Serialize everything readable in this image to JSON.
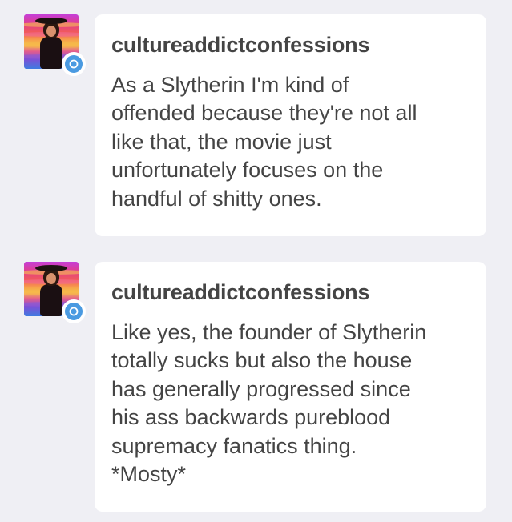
{
  "replies": [
    {
      "username": "cultureaddictconfessions",
      "avatar": "user-avatar-portrait",
      "badge_icon": "chat-bubble-icon",
      "message": "As a Slytherin I'm kind of\noffended because they're not all\nlike that, the movie just\nunfortunately focuses on the\nhandful of shitty ones."
    },
    {
      "username": "cultureaddictconfessions",
      "avatar": "user-avatar-portrait",
      "badge_icon": "chat-bubble-icon",
      "message": "Like yes, the founder of Slytherin\ntotally sucks but also the house\nhas generally progressed since\nhis ass backwards pureblood\nsupremacy fanatics thing.\n*Mosty*"
    }
  ],
  "colors": {
    "background": "#efeff4",
    "bubble": "#ffffff",
    "text": "#444444",
    "badge": "#4a9ae1"
  }
}
